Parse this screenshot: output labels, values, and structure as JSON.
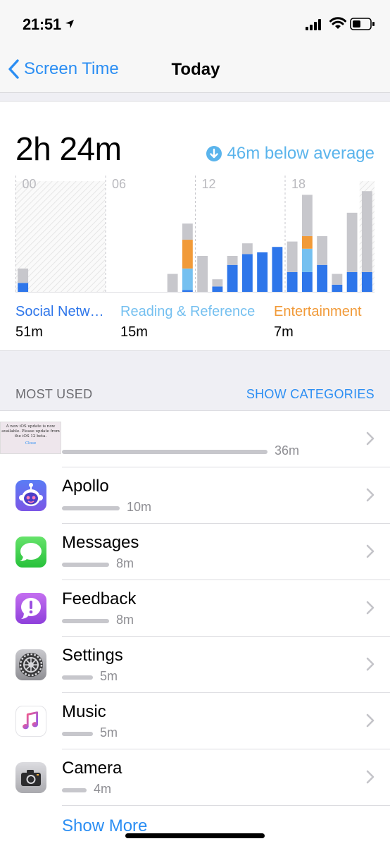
{
  "status_bar": {
    "time": "21:51"
  },
  "nav": {
    "back_label": "Screen Time",
    "title": "Today"
  },
  "summary": {
    "total": "2h 24m",
    "average_note": "46m below average"
  },
  "chart_data": {
    "type": "bar",
    "x_tick_labels": [
      "00",
      "06",
      "12",
      "18"
    ],
    "hours": 24,
    "ylim": [
      0,
      60
    ],
    "stack_order": [
      "Social Networking",
      "Reading & Reference",
      "Entertainment",
      "Other"
    ],
    "colors": {
      "Social Networking": "#2e76ea",
      "Reading & Reference": "#75c0f0",
      "Entertainment": "#f19a38",
      "Other": "#c7c7cc"
    },
    "inactive_hours": [
      0,
      1,
      2,
      3,
      4,
      5,
      23
    ],
    "series": [
      {
        "name": "Social Networking",
        "values": [
          5,
          0,
          0,
          0,
          0,
          0,
          0,
          0,
          0,
          0,
          0,
          1,
          0,
          3,
          15,
          21,
          22,
          25,
          11,
          11,
          15,
          4,
          11,
          11,
          18
        ]
      },
      {
        "name": "Reading & Reference",
        "values": [
          0,
          0,
          0,
          0,
          0,
          0,
          0,
          0,
          0,
          0,
          0,
          12,
          0,
          0,
          0,
          0,
          0,
          0,
          0,
          13,
          0,
          0,
          0,
          0,
          0
        ]
      },
      {
        "name": "Entertainment",
        "values": [
          0,
          0,
          0,
          0,
          0,
          0,
          0,
          0,
          0,
          0,
          0,
          16,
          0,
          0,
          0,
          0,
          0,
          0,
          0,
          7,
          0,
          0,
          0,
          0,
          0
        ]
      },
      {
        "name": "Other",
        "values": [
          8,
          0,
          0,
          0,
          0,
          0,
          0,
          0,
          0,
          0,
          10,
          9,
          20,
          4,
          5,
          6,
          0,
          0,
          17,
          23,
          16,
          6,
          33,
          45,
          43
        ]
      }
    ]
  },
  "categories": [
    {
      "name": "Social Netw…",
      "value": "51m",
      "color": "#2e76ea"
    },
    {
      "name": "Reading & Reference",
      "value": "15m",
      "color": "#75c0f0"
    },
    {
      "name": "Entertainment",
      "value": "7m",
      "color": "#f19a38"
    }
  ],
  "most_used": {
    "title": "MOST USED",
    "action": "SHOW CATEGORIES"
  },
  "apps": [
    {
      "name": "",
      "time": "36m",
      "fraction": 1.0,
      "icon": "screenshot-thumbnail",
      "thumb_lines": [
        "A new iOS update is now",
        "available. Please update from",
        "the iOS 12 beta."
      ],
      "thumb_close": "Close"
    },
    {
      "name": "Apollo",
      "time": "10m",
      "fraction": 0.28,
      "icon": "apollo-icon"
    },
    {
      "name": "Messages",
      "time": "8m",
      "fraction": 0.23,
      "icon": "messages-icon"
    },
    {
      "name": "Feedback",
      "time": "8m",
      "fraction": 0.23,
      "icon": "feedback-icon"
    },
    {
      "name": "Settings",
      "time": "5m",
      "fraction": 0.15,
      "icon": "settings-icon"
    },
    {
      "name": "Music",
      "time": "5m",
      "fraction": 0.15,
      "icon": "music-icon"
    },
    {
      "name": "Camera",
      "time": "4m",
      "fraction": 0.12,
      "icon": "camera-icon"
    }
  ],
  "show_more": "Show More"
}
